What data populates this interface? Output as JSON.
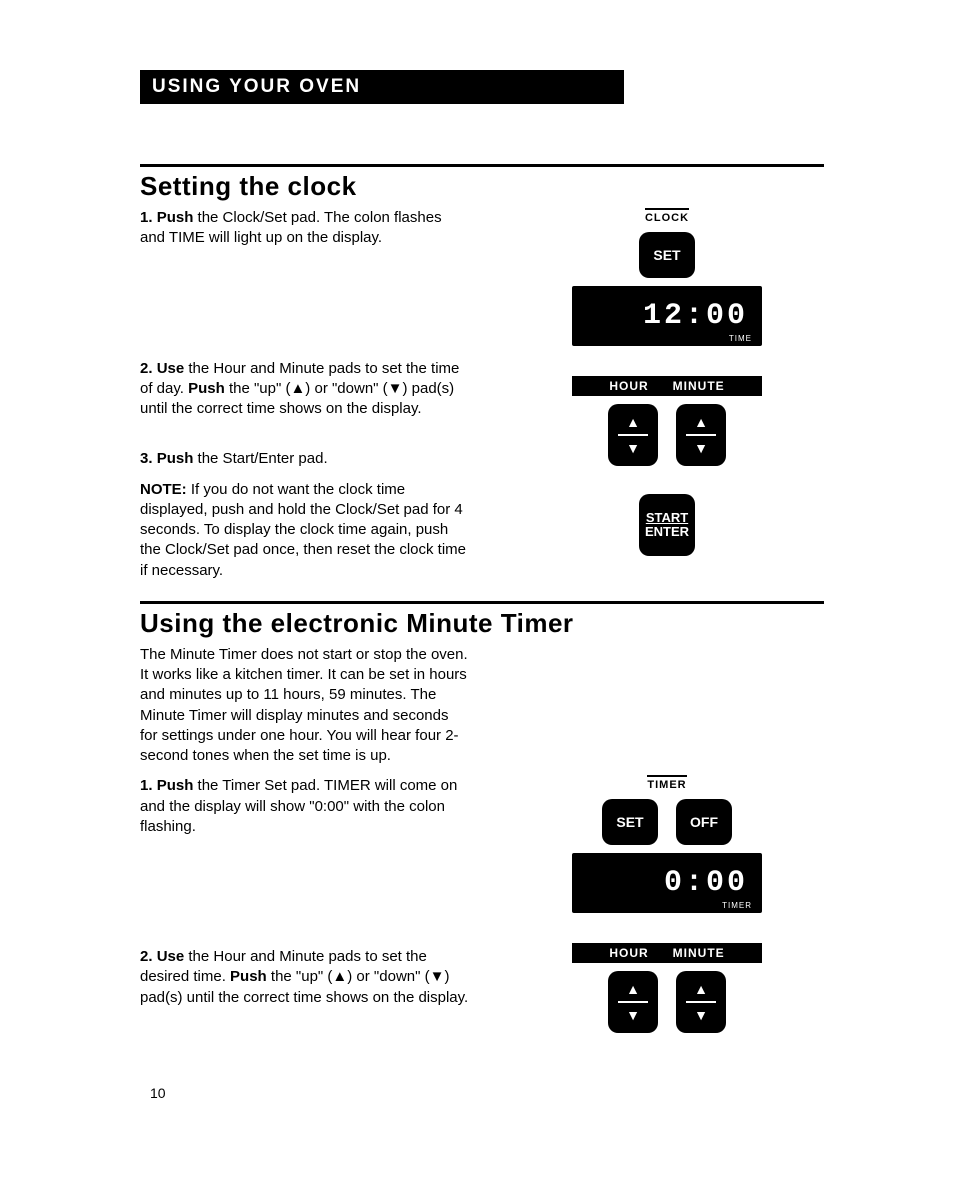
{
  "headerBar": "USING YOUR OVEN",
  "pageNumber": "10",
  "section1": {
    "title": "Setting the clock",
    "step1_n": "1.",
    "step1_a": "Push",
    "step1_b": " the Clock/Set pad. The colon flashes and TIME will light up on the display.",
    "step2_n": "2.",
    "step2_a": "Use",
    "step2_b": " the Hour and Minute pads to set the time of day. ",
    "step2_c": "Push",
    "step2_d": " the \"up\" (▲) or \"down\" (▼) pad(s) until the correct time shows on the display.",
    "step3_n": "3.",
    "step3_a": "Push",
    "step3_b": " the Start/Enter pad.",
    "note_a": "NOTE:",
    "note_b": " If you do not want the clock time displayed, push and hold the Clock/Set pad for 4 seconds. To display the clock time again, push the Clock/Set pad once, then reset the clock time if necessary.",
    "illus": {
      "clockLabel": "CLOCK",
      "setBtn": "SET",
      "lcdValue": "12:00",
      "lcdSub": "TIME",
      "hourLabel": "HOUR",
      "minuteLabel": "MINUTE",
      "startLine1": "START",
      "startLine2": "ENTER"
    }
  },
  "section2": {
    "title": "Using the electronic Minute Timer",
    "intro": "The Minute Timer does not start or stop the oven. It works like a kitchen timer. It can be set in hours and minutes up to 11 hours, 59 minutes. The Minute Timer will display minutes and seconds for settings under one hour. You will hear four 2-second tones when the set time is up.",
    "step1_n": "1.",
    "step1_a": "Push",
    "step1_b": " the Timer Set pad. TIMER will come on and the display will show \"0:00\" with the colon flashing.",
    "step2_n": "2.",
    "step2_a": "Use",
    "step2_b": " the Hour and Minute pads to set the desired time. ",
    "step2_c": "Push",
    "step2_d": " the \"up\" (▲) or \"down\" (▼) pad(s) until the correct time shows on the display.",
    "illus": {
      "timerLabel": "TIMER",
      "setBtn": "SET",
      "offBtn": "OFF",
      "lcdValue": "0:00",
      "lcdSub": "TIMER",
      "hourLabel": "HOUR",
      "minuteLabel": "MINUTE"
    }
  }
}
